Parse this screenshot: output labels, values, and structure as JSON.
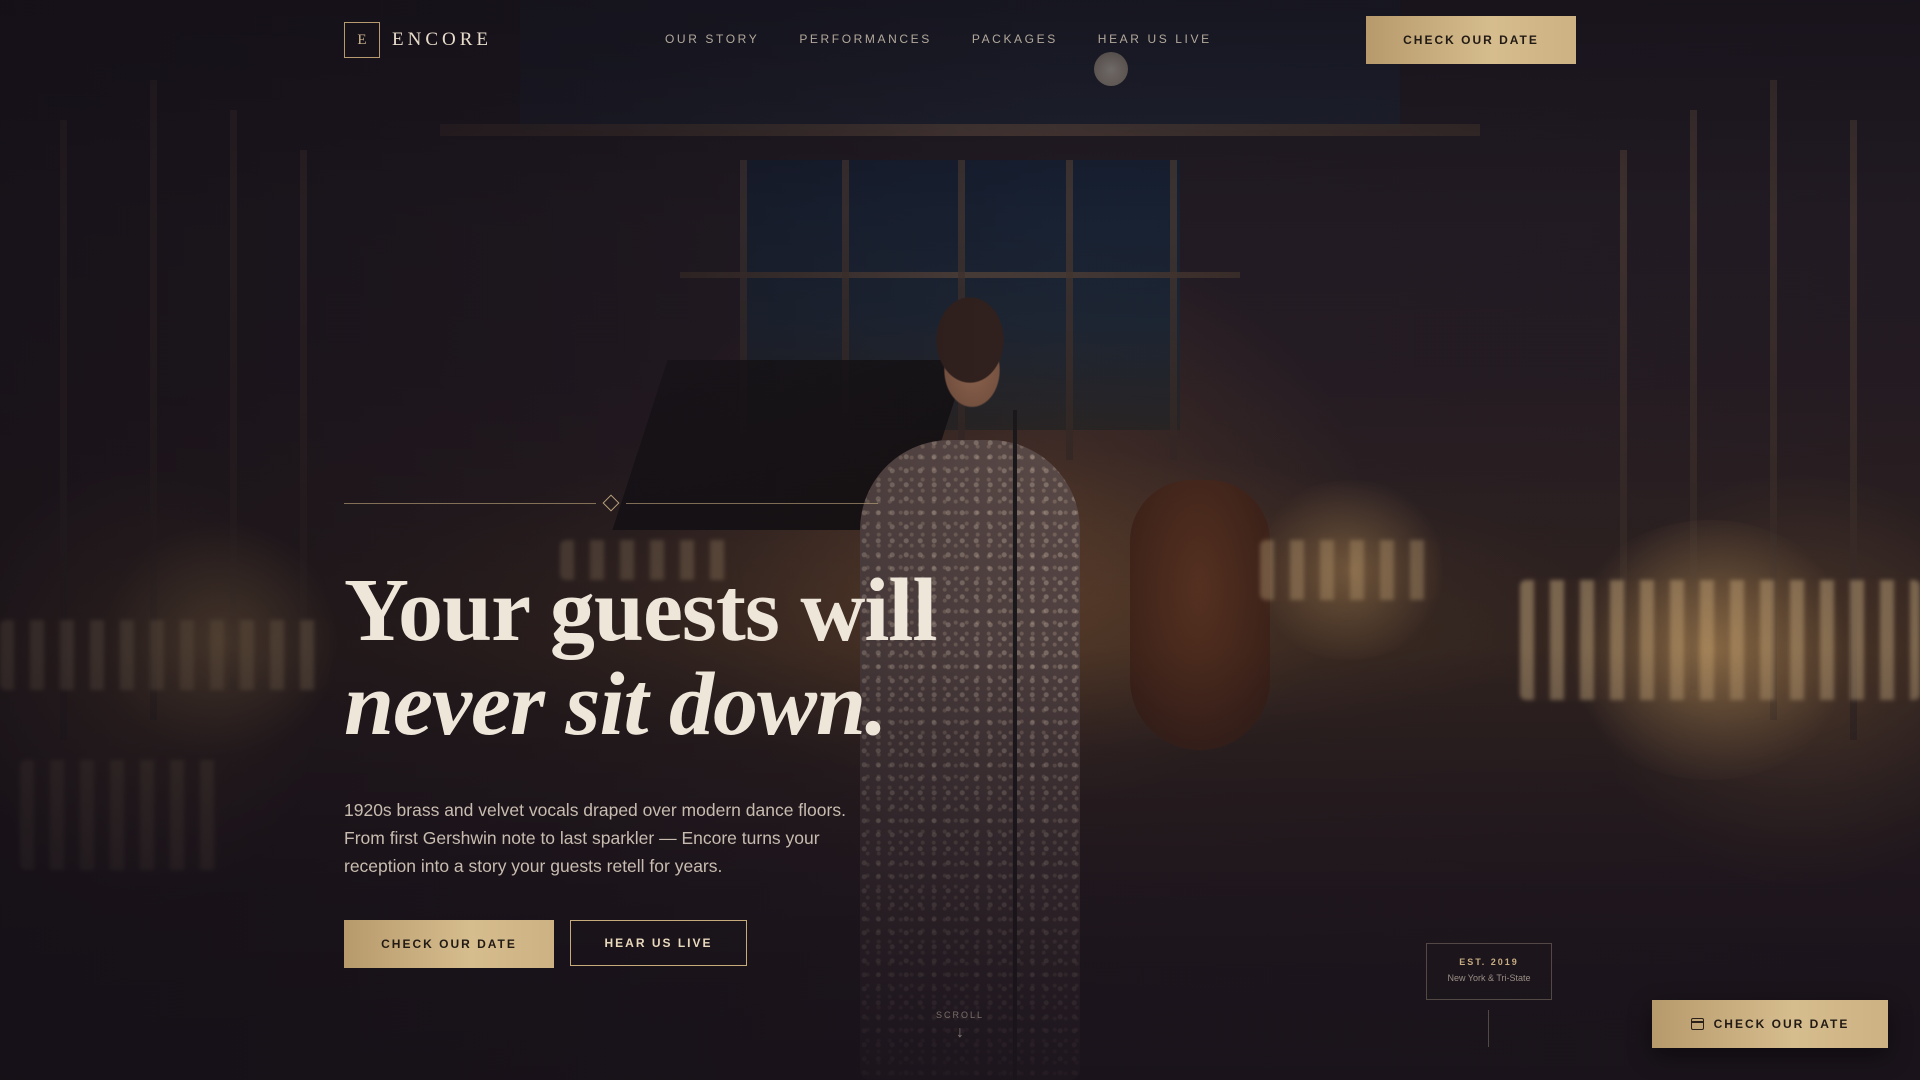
{
  "brand": {
    "mark": "E",
    "name": "ENCORE"
  },
  "nav": {
    "items": [
      {
        "label": "OUR STORY"
      },
      {
        "label": "PERFORMANCES"
      },
      {
        "label": "PACKAGES"
      },
      {
        "label": "HEAR US LIVE"
      }
    ],
    "cta_label": "CHECK OUR DATE"
  },
  "hero": {
    "headline_line1": "Your guests will",
    "headline_line2": "never sit down.",
    "lede": "1920s brass and velvet vocals draped over modern dance floors. From first Gershwin note to last sparkler — Encore turns your reception into a story your guests retell for years.",
    "primary_cta": "CHECK OUR DATE",
    "secondary_cta": "HEAR US LIVE"
  },
  "scroll": {
    "label": "SCROLL",
    "arrow": "↓"
  },
  "badge": {
    "title": "EST. 2019",
    "subtitle": "New York & Tri-State"
  },
  "floating_cta": {
    "label": "CHECK OUR DATE",
    "icon": "calendar-icon"
  },
  "colors": {
    "accent_gold": "#d6bd8e",
    "background": "#1b1520",
    "text": "#efe6da"
  }
}
